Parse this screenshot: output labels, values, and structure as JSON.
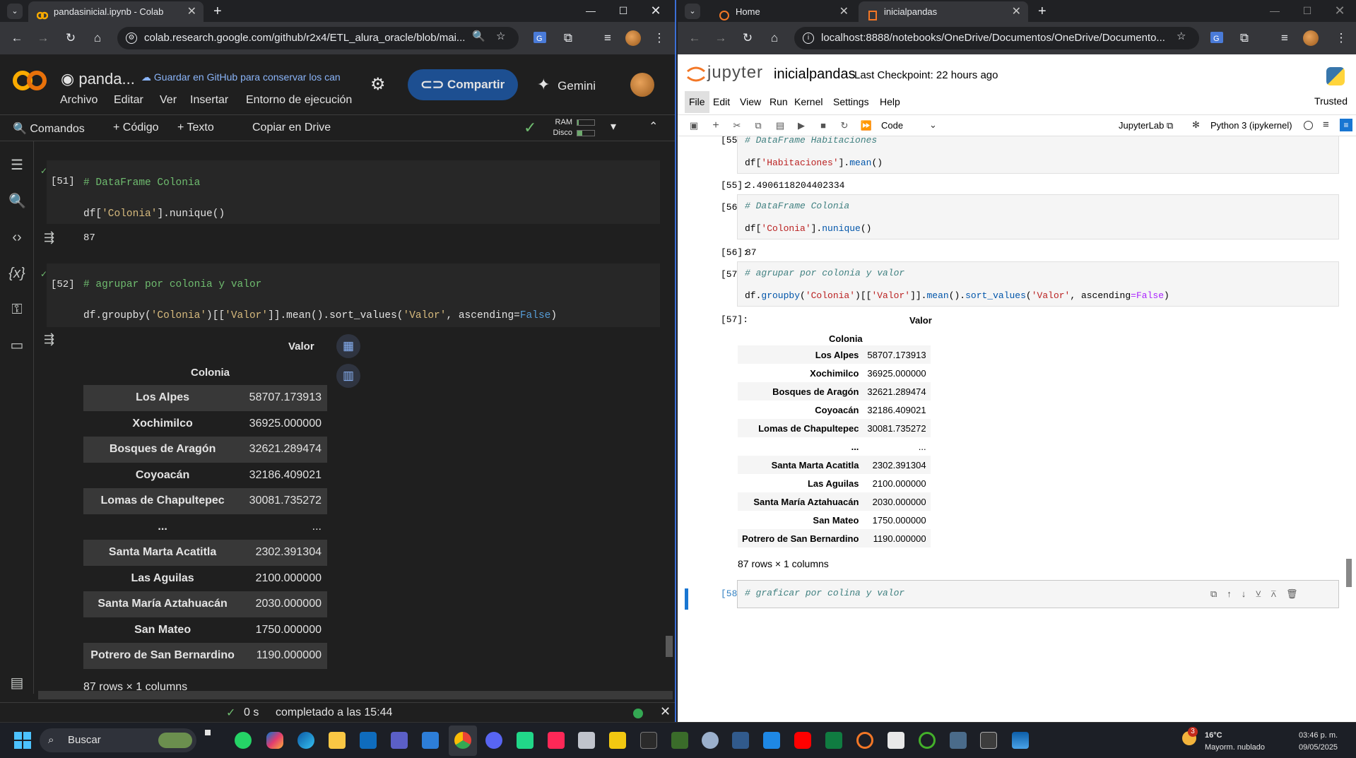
{
  "left_browser": {
    "tab_title": "pandasinicial.ipynb - Colab",
    "url": "colab.research.google.com/github/r2x4/ETL_alura_oracle/blob/mai...",
    "colab": {
      "title": "panda...",
      "github_msg": "Guardar en GitHub para conservar los can",
      "menu": [
        "Archivo",
        "Editar",
        "Ver",
        "Insertar",
        "Entorno de ejecución"
      ],
      "share_label": "Compartir",
      "gemini_label": "Gemini",
      "toolbar": {
        "commands": "Comandos",
        "code": "+ Código",
        "text": "+ Texto",
        "copy_drive": "Copiar en Drive",
        "ram": "RAM",
        "disk": "Disco"
      },
      "cell51": {
        "prompt": "[51]",
        "line1": "# DataFrame Colonia",
        "line2_a": "df[",
        "line2_str": "'Colonia'",
        "line2_b": "].nunique()",
        "output": "87",
        "exec_time": "0 s"
      },
      "cell52": {
        "prompt": "[52]",
        "line1": "# agrupar por colonia y valor",
        "p1": "df.groupby(",
        "s1": "'Colonia'",
        "p2": ")[[",
        "s2": "'Valor'",
        "p3": "]].mean().sort_values(",
        "s3": "'Valor'",
        "p4": ", ascending=",
        "k1": "False",
        "p5": ")",
        "exec_time": "0 s"
      },
      "df": {
        "col_header": "Valor",
        "index_name": "Colonia",
        "rows": [
          {
            "idx": "Los Alpes",
            "val": "58707.173913"
          },
          {
            "idx": "Xochimilco",
            "val": "36925.000000"
          },
          {
            "idx": "Bosques de Aragón",
            "val": "32621.289474"
          },
          {
            "idx": "Coyoacán",
            "val": "32186.409021"
          },
          {
            "idx": "Lomas de Chapultepec",
            "val": "30081.735272"
          },
          {
            "idx": "...",
            "val": "..."
          },
          {
            "idx": "Santa Marta Acatitla",
            "val": "2302.391304"
          },
          {
            "idx": "Las Aguilas",
            "val": "2100.000000"
          },
          {
            "idx": "Santa María Aztahuacán",
            "val": "2030.000000"
          },
          {
            "idx": "San Mateo",
            "val": "1750.000000"
          },
          {
            "idx": "Potrero de San Bernardino",
            "val": "1190.000000"
          }
        ],
        "footer": "87 rows × 1 columns"
      },
      "status": {
        "time": "0 s",
        "message": "completado a las 15:44"
      }
    }
  },
  "right_browser": {
    "tab1": "Home",
    "tab2": "inicialpandas",
    "url": "localhost:8888/notebooks/OneDrive/Documentos/OneDrive/Documento...",
    "jupyter": {
      "brand": "jupyter",
      "name": "inicialpandas",
      "checkpoint": "Last Checkpoint: 22 hours ago",
      "menu": [
        "File",
        "Edit",
        "View",
        "Run",
        "Kernel",
        "Settings",
        "Help"
      ],
      "trusted": "Trusted",
      "cell_type": "Code",
      "jupyterlab": "JupyterLab",
      "kernel": "Python 3 (ipykernel)",
      "c55": {
        "in": "[55]:",
        "c1": "# DataFrame Habitaciones",
        "a": "df[",
        "s": "'Habitaciones'",
        "b": "].",
        "f": "mean",
        "e": "()",
        "out": "2.4906118204402334"
      },
      "c56": {
        "in": "[56]:",
        "c1": "# DataFrame Colonia",
        "a": "df[",
        "s": "'Colonia'",
        "b": "].",
        "f": "nunique",
        "e": "()",
        "out": "87"
      },
      "c57": {
        "in": "[57]:",
        "c1": "# agrupar por colonia y valor",
        "a": "df.",
        "f1": "groupby",
        "b": "(",
        "s1": "'Colonia'",
        "c": ")[[",
        "s2": "'Valor'",
        "d": "]].",
        "f2": "mean",
        "e": "().",
        "f3": "sort_values",
        "g": "(",
        "s3": "'Valor'",
        "h": ", ascending",
        "eq": "=",
        "k": "False",
        "i": ")"
      },
      "c58": {
        "in": "[58]:",
        "c1": "# graficar por colina y valor"
      },
      "out57_prompt": "[57]:"
    }
  },
  "taskbar": {
    "search": "Buscar",
    "weather_temp": "16°C",
    "weather_desc": "Mayorm. nublado",
    "time": "03:46 p. m.",
    "date": "09/05/2025",
    "badge": "3"
  }
}
